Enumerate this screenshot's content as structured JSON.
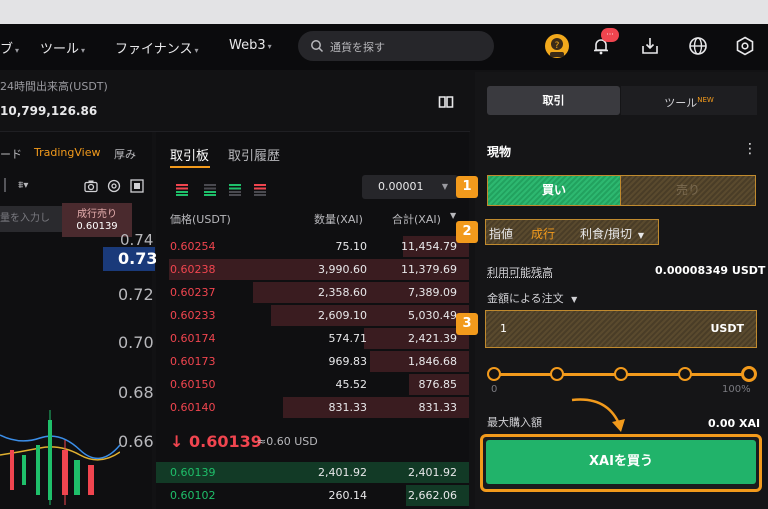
{
  "nav": {
    "items": [
      {
        "label": "ブ",
        "caret": "▾"
      },
      {
        "label": "ツール",
        "caret": "▾"
      },
      {
        "label": "ファイナンス",
        "caret": "▾"
      },
      {
        "label": "Web3",
        "caret": "▾"
      }
    ],
    "search_placeholder": "通貨を探す",
    "notification_badge": "···"
  },
  "stats": {
    "label": "24時間出来高(USDT)",
    "value": "10,799,126.86"
  },
  "chart": {
    "tabs": [
      "ード",
      "TradingView",
      "厚み"
    ],
    "active_tab": "TradingView",
    "input_placeholder": "量を入力し",
    "market_sell_label": "成行売り",
    "market_sell_price": "0.60139",
    "axis_labels": [
      "0.74",
      "0.73",
      "0.72",
      "0.70",
      "0.68",
      "0.66"
    ],
    "highlighted_axis": "0.73"
  },
  "orderbook": {
    "tabs": [
      "取引板",
      "取引履歴"
    ],
    "precision": "0.00001",
    "headers": {
      "price": "価格(USDT)",
      "qty": "数量(XAI)",
      "total": "合計(XAI)"
    },
    "asks": [
      {
        "price": "0.60254",
        "qty": "75.10",
        "total": "11,454.79",
        "depth": 0.22
      },
      {
        "price": "0.60238",
        "qty": "3,990.60",
        "total": "11,379.69",
        "depth": 1.0
      },
      {
        "price": "0.60237",
        "qty": "2,358.60",
        "total": "7,389.09",
        "depth": 0.72
      },
      {
        "price": "0.60233",
        "qty": "2,609.10",
        "total": "5,030.49",
        "depth": 0.66
      },
      {
        "price": "0.60174",
        "qty": "574.71",
        "total": "2,421.39",
        "depth": 0.35
      },
      {
        "price": "0.60173",
        "qty": "969.83",
        "total": "1,846.68",
        "depth": 0.33
      },
      {
        "price": "0.60150",
        "qty": "45.52",
        "total": "876.85",
        "depth": 0.2
      },
      {
        "price": "0.60140",
        "qty": "831.33",
        "total": "831.33",
        "depth": 0.62
      }
    ],
    "last_price": "0.60139",
    "last_price_arrow": "↓",
    "last_price_usd": "≈0.60 USD",
    "bids": [
      {
        "price": "0.60139",
        "qty": "2,401.92",
        "total": "2,401.92",
        "depth": 1.0
      },
      {
        "price": "0.60102",
        "qty": "260.14",
        "total": "2,662.06",
        "depth": 0.2
      }
    ]
  },
  "trade": {
    "tabs": [
      "取引",
      "ツール"
    ],
    "tab_badge": "NEW",
    "section_title": "現物",
    "buy_label": "買い",
    "sell_label": "売り",
    "order_types": [
      "指値",
      "成行",
      "利食/損切"
    ],
    "active_order_type": "成行",
    "available_label": "利用可能残高",
    "available_value": "0.00008349 USDT",
    "order_by_label": "金額による注文",
    "amount_value": "1",
    "amount_unit": "USDT",
    "slider_min": "0",
    "slider_max": "100%",
    "slider_value": 1.0,
    "max_buy_label": "最大購入額",
    "max_buy_value": "0.00 XAI",
    "buy_button": "XAIを買う"
  },
  "steps": [
    "1",
    "2",
    "3"
  ],
  "colors": {
    "accent": "#f29a1c",
    "buy": "#21b36a",
    "sell": "#f0454f"
  }
}
